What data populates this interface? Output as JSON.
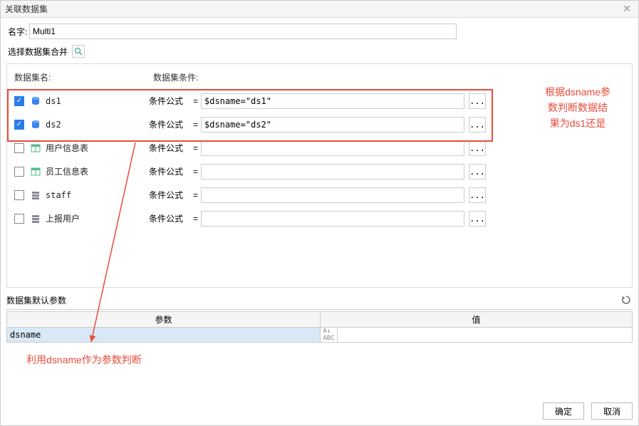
{
  "window": {
    "title": "关联数据集"
  },
  "name": {
    "label": "名字:",
    "value": "Multi1"
  },
  "select": {
    "label": "选择数据集合并"
  },
  "panel": {
    "header_dsname": "数据集名:",
    "header_cond": "数据集条件:",
    "cond_label": "条件公式",
    "eq": "=",
    "ellipsis": "...",
    "rows": [
      {
        "checked": true,
        "icon": "db-blue",
        "name": "ds1",
        "cond": "$dsname=\"ds1\""
      },
      {
        "checked": true,
        "icon": "db-blue",
        "name": "ds2",
        "cond": "$dsname=\"ds2\""
      },
      {
        "checked": false,
        "icon": "table",
        "name": "用户信息表",
        "cond": ""
      },
      {
        "checked": false,
        "icon": "table",
        "name": "员工信息表",
        "cond": ""
      },
      {
        "checked": false,
        "icon": "server",
        "name": "staff",
        "cond": ""
      },
      {
        "checked": false,
        "icon": "server",
        "name": "上报用户",
        "cond": ""
      }
    ]
  },
  "annotation1": {
    "l1": "根据dsname参",
    "l2": "数判断数据结",
    "l3": "果为ds1还是"
  },
  "params": {
    "title": "数据集默认参数",
    "th_param": "参数",
    "th_value": "值",
    "row": {
      "name": "dsname",
      "value": ""
    }
  },
  "annotation2": "利用dsname作为参数判断",
  "footer": {
    "ok": "确定",
    "cancel": "取消"
  }
}
